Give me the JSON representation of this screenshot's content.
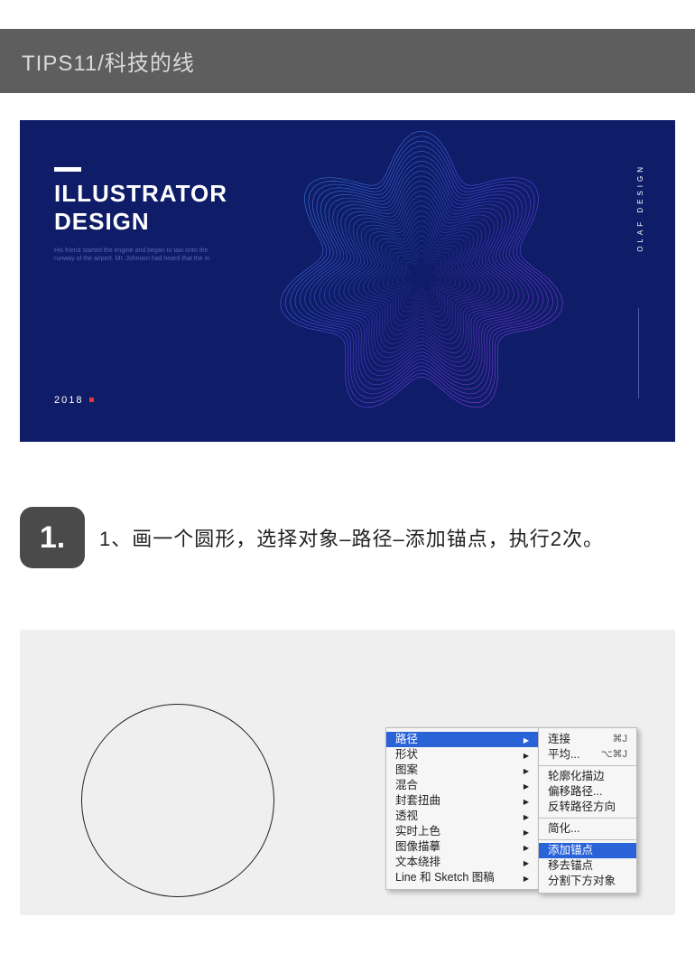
{
  "header": {
    "title": "TIPS11/科技的线"
  },
  "poster": {
    "heading": "ILLUSTRATOR\nDESIGN",
    "sub": "His friend started the engine and began to taxi onto the runway of the airport. Mr. Johnson had heard that the m",
    "year": "2018",
    "right_label": "OLAF DESIGN"
  },
  "step": {
    "badge": "1.",
    "text": "1、画一个圆形，选择对象–路径–添加锚点，执行2次。"
  },
  "menu1": {
    "items": [
      {
        "label": "路径",
        "sub": true,
        "selected": true
      },
      {
        "label": "形状",
        "sub": true
      },
      {
        "label": "图案",
        "sub": true
      },
      {
        "label": "混合",
        "sub": true
      },
      {
        "label": "封套扭曲",
        "sub": true
      },
      {
        "label": "透视",
        "sub": true
      },
      {
        "label": "实时上色",
        "sub": true
      },
      {
        "label": "图像描摹",
        "sub": true
      },
      {
        "label": "文本绕排",
        "sub": true
      },
      {
        "label": "Line 和 Sketch 图稿",
        "sub": true
      }
    ]
  },
  "menu2": {
    "groups": [
      [
        {
          "label": "连接",
          "shortcut": "⌘J"
        },
        {
          "label": "平均...",
          "shortcut": "⌥⌘J"
        }
      ],
      [
        {
          "label": "轮廓化描边"
        },
        {
          "label": "偏移路径..."
        },
        {
          "label": "反转路径方向"
        }
      ],
      [
        {
          "label": "简化..."
        }
      ],
      [
        {
          "label": "添加锚点",
          "selected": true
        },
        {
          "label": "移去锚点"
        },
        {
          "label": "分割下方对象"
        }
      ]
    ]
  }
}
